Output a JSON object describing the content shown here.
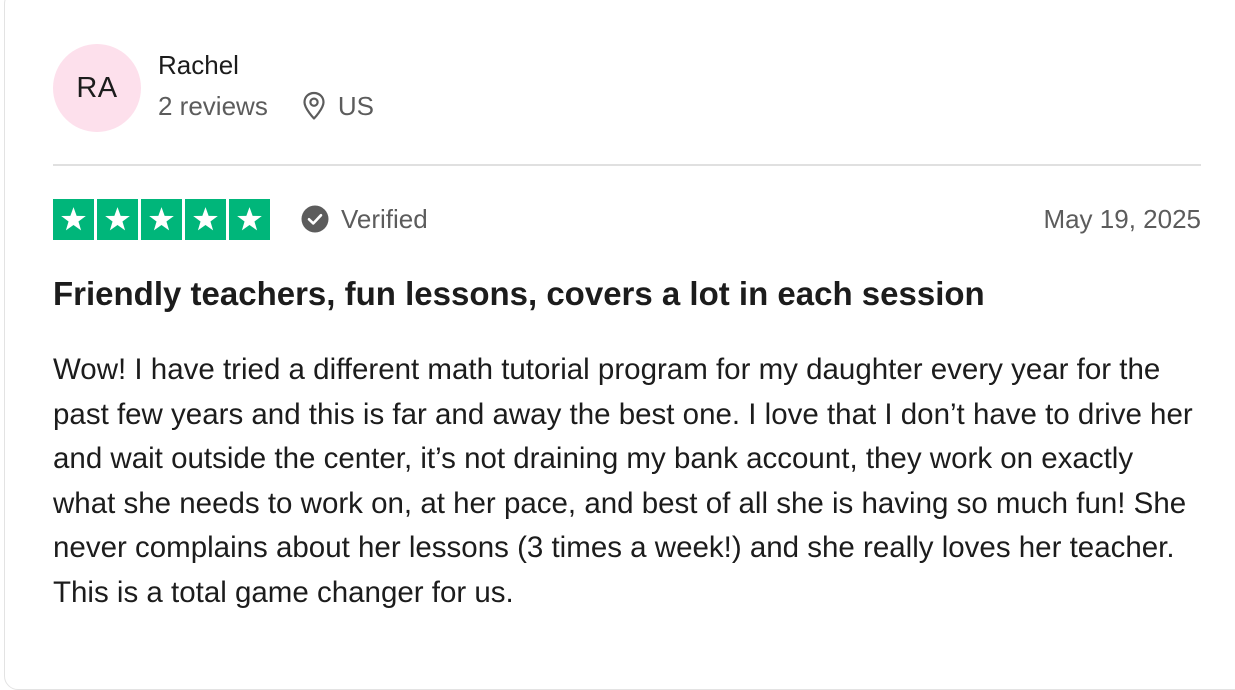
{
  "reviewer": {
    "initials": "RA",
    "name": "Rachel",
    "review_count": "2 reviews",
    "location": "US",
    "avatar_color": "#fde0ec"
  },
  "rating": {
    "stars": 5,
    "max_stars": 5,
    "star_color": "#00b67a",
    "verified_label": "Verified",
    "date": "May 19, 2025"
  },
  "review": {
    "title": "Friendly teachers, fun lessons, covers a lot in each session",
    "body": "Wow! I have tried a different math tutorial program for my daughter every year for the past few years and this is far and away the best one. I love that I don’t have to drive her and wait outside the center, it’s not draining my bank account, they work on exactly what she needs to work on, at her pace, and best of all she is having so much fun! She never complains about her lessons (3 times a week!) and she really loves her teacher. This is a total game changer for us."
  },
  "icons": {
    "location": "map-pin-icon",
    "verified": "check-circle-icon",
    "star": "star-icon"
  }
}
